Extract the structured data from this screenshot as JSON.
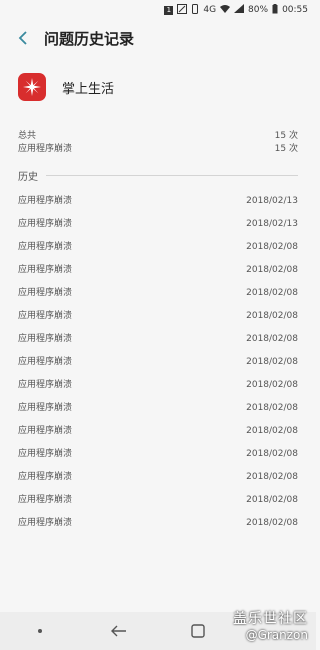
{
  "status_bar": {
    "battery": "80%",
    "time": "00:55",
    "network": "4G"
  },
  "header": {
    "title": "问题历史记录"
  },
  "app": {
    "name": "掌上生活",
    "icon_color": "#d82d2d"
  },
  "summary": {
    "total_label": "总共",
    "total_count": "15 次",
    "crash_label": "应用程序崩溃",
    "crash_count": "15 次"
  },
  "history": {
    "label": "历史",
    "items": [
      {
        "label": "应用程序崩溃",
        "date": "2018/02/13"
      },
      {
        "label": "应用程序崩溃",
        "date": "2018/02/13"
      },
      {
        "label": "应用程序崩溃",
        "date": "2018/02/08"
      },
      {
        "label": "应用程序崩溃",
        "date": "2018/02/08"
      },
      {
        "label": "应用程序崩溃",
        "date": "2018/02/08"
      },
      {
        "label": "应用程序崩溃",
        "date": "2018/02/08"
      },
      {
        "label": "应用程序崩溃",
        "date": "2018/02/08"
      },
      {
        "label": "应用程序崩溃",
        "date": "2018/02/08"
      },
      {
        "label": "应用程序崩溃",
        "date": "2018/02/08"
      },
      {
        "label": "应用程序崩溃",
        "date": "2018/02/08"
      },
      {
        "label": "应用程序崩溃",
        "date": "2018/02/08"
      },
      {
        "label": "应用程序崩溃",
        "date": "2018/02/08"
      },
      {
        "label": "应用程序崩溃",
        "date": "2018/02/08"
      },
      {
        "label": "应用程序崩溃",
        "date": "2018/02/08"
      },
      {
        "label": "应用程序崩溃",
        "date": "2018/02/08"
      }
    ]
  },
  "watermark": {
    "line1": "盖乐世社区",
    "line2": "@Granzon"
  }
}
